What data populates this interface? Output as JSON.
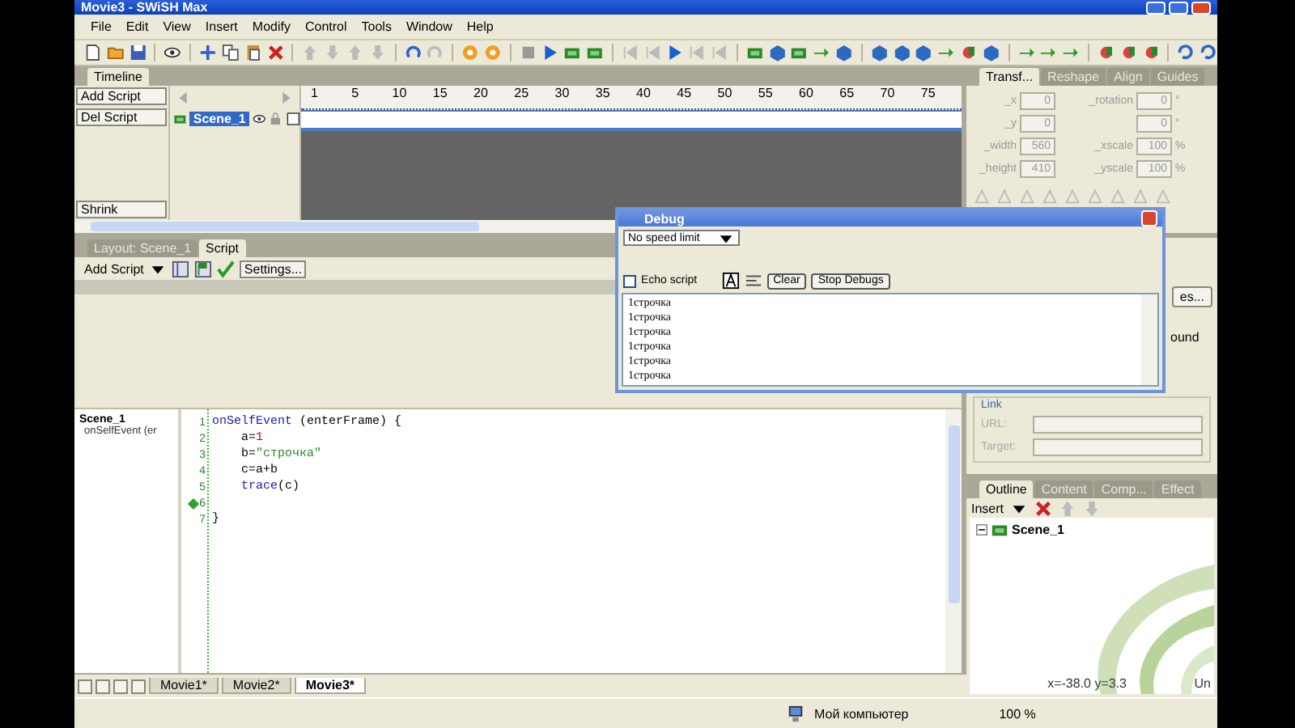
{
  "window": {
    "title": "Movie3 - SWiSH Max"
  },
  "menu": [
    "File",
    "Edit",
    "View",
    "Insert",
    "Modify",
    "Control",
    "Tools",
    "Window",
    "Help"
  ],
  "timeline": {
    "tab": "Timeline",
    "add_script": "Add Script",
    "del_script": "Del Script",
    "shrink": "Shrink",
    "scene": {
      "name": "Scene_1",
      "selected": true
    },
    "ruler": [
      "1",
      "5",
      "10",
      "15",
      "20",
      "25",
      "30",
      "35",
      "40",
      "45",
      "50",
      "55",
      "60",
      "65",
      "70",
      "75"
    ]
  },
  "transform_panel": {
    "tabs": [
      {
        "label": "Transf...",
        "selected": true
      },
      {
        "label": "Reshape",
        "selected": false
      },
      {
        "label": "Align",
        "selected": false
      },
      {
        "label": "Guides",
        "selected": false
      }
    ],
    "fields": [
      {
        "label": "_x",
        "value": "0"
      },
      {
        "label": "_rotation",
        "value": "0",
        "unit": "°"
      },
      {
        "label": "_y",
        "value": "0"
      },
      {
        "value": "0",
        "unit": "°"
      },
      {
        "label": "_width",
        "value": "560"
      },
      {
        "label": "_xscale",
        "value": "100",
        "unit": "%"
      },
      {
        "label": "_height",
        "value": "410"
      },
      {
        "label": "_yscale",
        "value": "100",
        "unit": "%"
      }
    ]
  },
  "script_panel": {
    "tabs": [
      {
        "label": "Layout: Scene_1",
        "selected": false
      },
      {
        "label": "Script",
        "selected": true
      }
    ],
    "add_script": "Add Script",
    "settings": "Settings...",
    "tree": {
      "label": "Scene_1",
      "children": [
        {
          "label": "onSelfEvent (er"
        }
      ]
    },
    "code": [
      {
        "number": "1",
        "breakpoint": false,
        "tokens": [
          {
            "kind": "keyword",
            "text": "onSelfEvent"
          },
          {
            "kind": "plain",
            "text": " (enterFrame) {"
          }
        ]
      },
      {
        "number": "2",
        "breakpoint": false,
        "tokens": [
          {
            "kind": "plain",
            "text": "    a="
          },
          {
            "kind": "number",
            "text": "1"
          }
        ]
      },
      {
        "number": "3",
        "breakpoint": false,
        "tokens": [
          {
            "kind": "plain",
            "text": "    b="
          },
          {
            "kind": "string",
            "text": "\"строчка\""
          }
        ]
      },
      {
        "number": "4",
        "breakpoint": false,
        "tokens": [
          {
            "kind": "plain",
            "text": "    c=a+b"
          }
        ]
      },
      {
        "number": "5",
        "breakpoint": false,
        "tokens": [
          {
            "kind": "keyword",
            "text": "    trace"
          },
          {
            "kind": "plain",
            "text": "(c)"
          }
        ]
      },
      {
        "number": "6",
        "breakpoint": true
      },
      {
        "number": "7",
        "breakpoint": false,
        "tokens": [
          {
            "kind": "plain",
            "text": "}"
          }
        ]
      }
    ]
  },
  "debug": {
    "title": "Debug",
    "speed": "No speed limit",
    "echo": {
      "label": "Echo script",
      "checked": false
    },
    "clear": "Clear",
    "stop": "Stop Debugs",
    "output": [
      "1строчка",
      "1строчка",
      "1строчка",
      "1строчка",
      "1строчка",
      "1строчка"
    ]
  },
  "properties_panel": {
    "button": "es...",
    "text": "ound",
    "link": {
      "title": "Link",
      "url_label": "URL:",
      "target_label": "Target:"
    }
  },
  "outline_panel": {
    "tabs": [
      {
        "label": "Outline",
        "selected": true
      },
      {
        "label": "Content",
        "selected": false
      },
      {
        "label": "Comp...",
        "selected": false
      },
      {
        "label": "Effect",
        "selected": false
      }
    ],
    "insert": "Insert",
    "tree": {
      "label": "Scene_1",
      "expanded": true
    }
  },
  "movie_tabs": [
    {
      "label": "Movie1*",
      "selected": false
    },
    {
      "label": "Movie2*",
      "selected": false
    },
    {
      "label": "Movie3*",
      "selected": true
    }
  ],
  "coords": "x=-38.0 y=3.3",
  "units": "Un",
  "status_bar": {
    "computer": "Мой компьютер",
    "zoom": "100 %"
  }
}
